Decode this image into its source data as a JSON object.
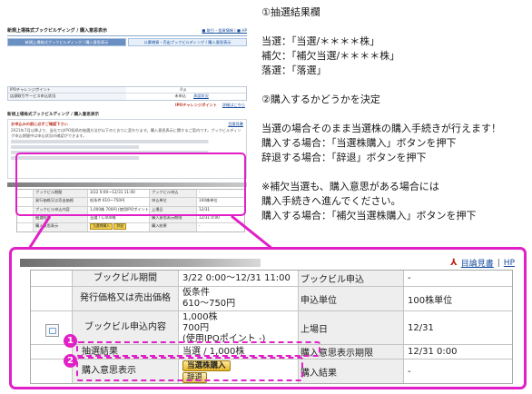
{
  "mini": {
    "title": "新規上場株式ブックビルディング / 購入意思表示",
    "top_links": "■ 取引・投資情報 | ■ HP",
    "tabs": [
      "新規上場株式ブックビルディング / 購入意思表示",
      "公募増資・売出ブックビルディング / 購入意思表示"
    ],
    "info_rows": [
      {
        "label": "IPOチャレンジポイント",
        "value": "0 p",
        "extra": ""
      },
      {
        "label": "店頭取引サービス申込状況",
        "value": "未申込",
        "extra": "承認状況"
      }
    ],
    "ipo_challenge_link": "IPOチャレンジポイント",
    "detail_link": "詳細はこちら",
    "section_title": "新規上場株式ブックビルディング / 購入意思表示",
    "notice_title": "お申込みの前に必ずご確認下さい",
    "notice_link": "目論見書",
    "notice_text": "2021年7月以降より、当社ではIPO銘柄の抽選方法が以下のとおりに変わります。購入意思表示に関するご案内です。ブックビルディング申込期間中は申込状況の確認ができます。",
    "rows": [
      {
        "label": "ブックビル期間",
        "value": "3/22 0:00〜12/31 11:00",
        "label2": "ブックビル申込",
        "value2": "-"
      },
      {
        "label": "発行価格又は売出価格",
        "value": "仮条件 610〜750円",
        "label2": "申込単位",
        "value2": "100株単位"
      },
      {
        "label": "ブックビル申込内容",
        "value": "1,000株 700円 (使用IPOポイント -)",
        "label2": "上場日",
        "value2": "12/31"
      },
      {
        "label": "抽選結果",
        "value": "当選 / 1,000株",
        "label2": "購入意思表示期限",
        "value2": "12/31 0:00"
      },
      {
        "label": "購入意思表示",
        "value": "",
        "label2": "購入結果",
        "value2": "-"
      }
    ],
    "buy_button": "当選株購入",
    "decline_button": "辞退"
  },
  "notes": {
    "lines": [
      "①抽選結果欄",
      "",
      "当選：「当選/＊＊＊＊株」",
      "補欠：「補欠当選/＊＊＊＊株」",
      "落選：「落選」",
      "",
      "②購入するかどうかを決定",
      "",
      "当選の場合そのまま当選株の購入手続きが行えます！",
      "購入する場合：「当選株購入」ボタンを押下",
      "辞退する場合：「辞退」ボタンを押下",
      "",
      "※補欠当選も、購入意思がある場合には",
      "購入手続きへ進んでください。",
      "購入する場合：「補欠当選株購入」ボタンを押下"
    ]
  },
  "zoom": {
    "links": {
      "prospectus": "目論見書",
      "separator": "|",
      "hp": "HP"
    },
    "rows": {
      "period": {
        "label": "ブックビル期間",
        "value": "3/22 0:00〜12/31 11:00",
        "label2": "ブックビル申込",
        "value2": "-"
      },
      "price": {
        "label": "発行価格又は売出価格",
        "value_line1": "仮条件",
        "value_line2": "610〜750円",
        "label2": "申込単位",
        "value2": "100株単位"
      },
      "content": {
        "label": "ブックビル申込内容",
        "value_line1": "1,000株",
        "value_line2": "700円",
        "value_line3": "(使用IPOポイント -)",
        "label2": "上場日",
        "value2": "12/31"
      },
      "lottery": {
        "label": "抽選結果",
        "value": "当選 / 1,000株",
        "label2": "購入意思表示期限",
        "value2": "12/31 0:00"
      },
      "intent": {
        "label": "購入意思表示",
        "label2": "購入結果",
        "value2": "-"
      }
    },
    "buy_button": "当選株購入",
    "decline_button": "辞退",
    "badges": [
      "1",
      "2"
    ]
  },
  "colors": {
    "highlight": "#e020c6",
    "link": "#1a4fa0",
    "button": "#f3d24c"
  }
}
